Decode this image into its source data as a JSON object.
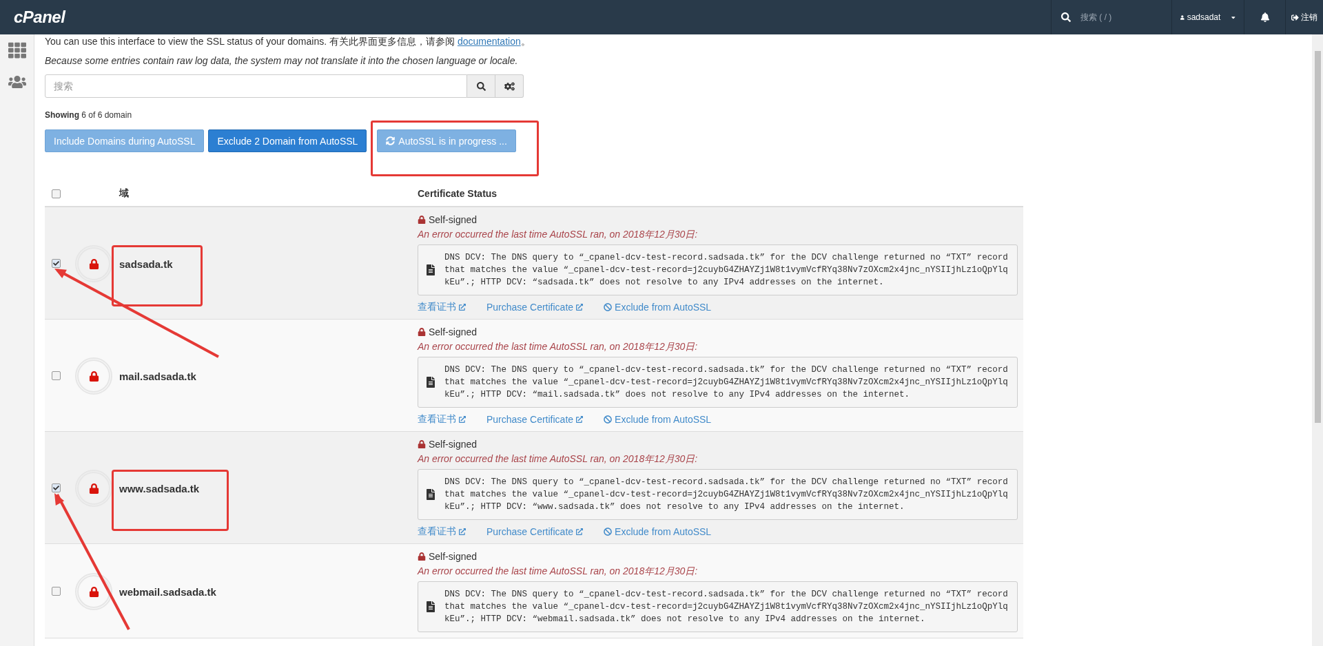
{
  "header": {
    "logo": "cPanel",
    "search_placeholder": "搜索 ( / )",
    "user": "sadsadat",
    "logout": "注销"
  },
  "intro": {
    "text": "You can use this interface to view the SSL status of your domains. 有关此界面更多信息，请参阅 ",
    "link": "documentation",
    "end": "。"
  },
  "note": "Because some entries contain raw log data, the system may not translate it into the chosen language or locale.",
  "search": {
    "placeholder": "搜索"
  },
  "showing": "**Showing** 6 of 6 domain",
  "buttons": [
    {
      "label": "Include Domains during AutoSSL",
      "kind": "light",
      "annotated": false
    },
    {
      "label": "Exclude 2 Domain from AutoSSL",
      "kind": "primary",
      "annotated": false
    },
    {
      "label": "AutoSSL is in progress ...",
      "kind": "progress",
      "annotated": true
    }
  ],
  "table": {
    "select_all": {
      "checked": false
    },
    "columns": [
      "域",
      "Certificate Status"
    ],
    "rows": [
      {
        "domain": "sadsada.tk",
        "checked": true,
        "annotated": true,
        "arrow": true,
        "status": "Self-signed",
        "error": "An error occurred the last time AutoSSL ran, on 2018年12月30日:",
        "log": "DNS DCV: The DNS query to “_cpanel-dcv-test-record.sadsada.tk” for the DCV challenge returned no “TXT” record that matches the value “_cpanel-dcv-test-record=j2cuybG4ZHAYZj1W8t1vymVcfRYq38Nv7zOXcm2x4jnc_nYSIIjhLz1oQpYlqkEu”.; HTTP DCV: “sadsada.tk” does not resolve to any IPv4 addresses on the internet.",
        "actions": [
          {
            "label": "查看证书",
            "kind": "external"
          },
          {
            "label": "Purchase Certificate",
            "kind": "external"
          },
          {
            "label": "Exclude from AutoSSL",
            "kind": "ban"
          }
        ]
      },
      {
        "domain": "mail.sadsada.tk",
        "checked": false,
        "annotated": false,
        "arrow": false,
        "status": "Self-signed",
        "error": "An error occurred the last time AutoSSL ran, on 2018年12月30日:",
        "log": "DNS DCV: The DNS query to “_cpanel-dcv-test-record.sadsada.tk” for the DCV challenge returned no “TXT” record that matches the value “_cpanel-dcv-test-record=j2cuybG4ZHAYZj1W8t1vymVcfRYq38Nv7zOXcm2x4jnc_nYSIIjhLz1oQpYlqkEu”.; HTTP DCV: “mail.sadsada.tk” does not resolve to any IPv4 addresses on the internet.",
        "actions": [
          {
            "label": "查看证书",
            "kind": "external"
          },
          {
            "label": "Purchase Certificate",
            "kind": "external"
          },
          {
            "label": "Exclude from AutoSSL",
            "kind": "ban"
          }
        ]
      },
      {
        "domain": "www.sadsada.tk",
        "checked": true,
        "annotated": true,
        "arrow": true,
        "status": "Self-signed",
        "error": "An error occurred the last time AutoSSL ran, on 2018年12月30日:",
        "log": "DNS DCV: The DNS query to “_cpanel-dcv-test-record.sadsada.tk” for the DCV challenge returned no “TXT” record that matches the value “_cpanel-dcv-test-record=j2cuybG4ZHAYZj1W8t1vymVcfRYq38Nv7zOXcm2x4jnc_nYSIIjhLz1oQpYlqkEu”.; HTTP DCV: “www.sadsada.tk” does not resolve to any IPv4 addresses on the internet.",
        "actions": [
          {
            "label": "查看证书",
            "kind": "external"
          },
          {
            "label": "Purchase Certificate",
            "kind": "external"
          },
          {
            "label": "Exclude from AutoSSL",
            "kind": "ban"
          }
        ]
      },
      {
        "domain": "webmail.sadsada.tk",
        "checked": false,
        "annotated": false,
        "arrow": false,
        "status": "Self-signed",
        "error": "An error occurred the last time AutoSSL ran, on 2018年12月30日:",
        "log": "DNS DCV: The DNS query to “_cpanel-dcv-test-record.sadsada.tk” for the DCV challenge returned no “TXT” record that matches the value “_cpanel-dcv-test-record=j2cuybG4ZHAYZj1W8t1vymVcfRYq38Nv7zOXcm2x4jnc_nYSIIjhLz1oQpYlqkEu”.; HTTP DCV: “webmail.sadsada.tk” does not resolve to any IPv4 addresses on the internet.",
        "actions": []
      }
    ]
  }
}
